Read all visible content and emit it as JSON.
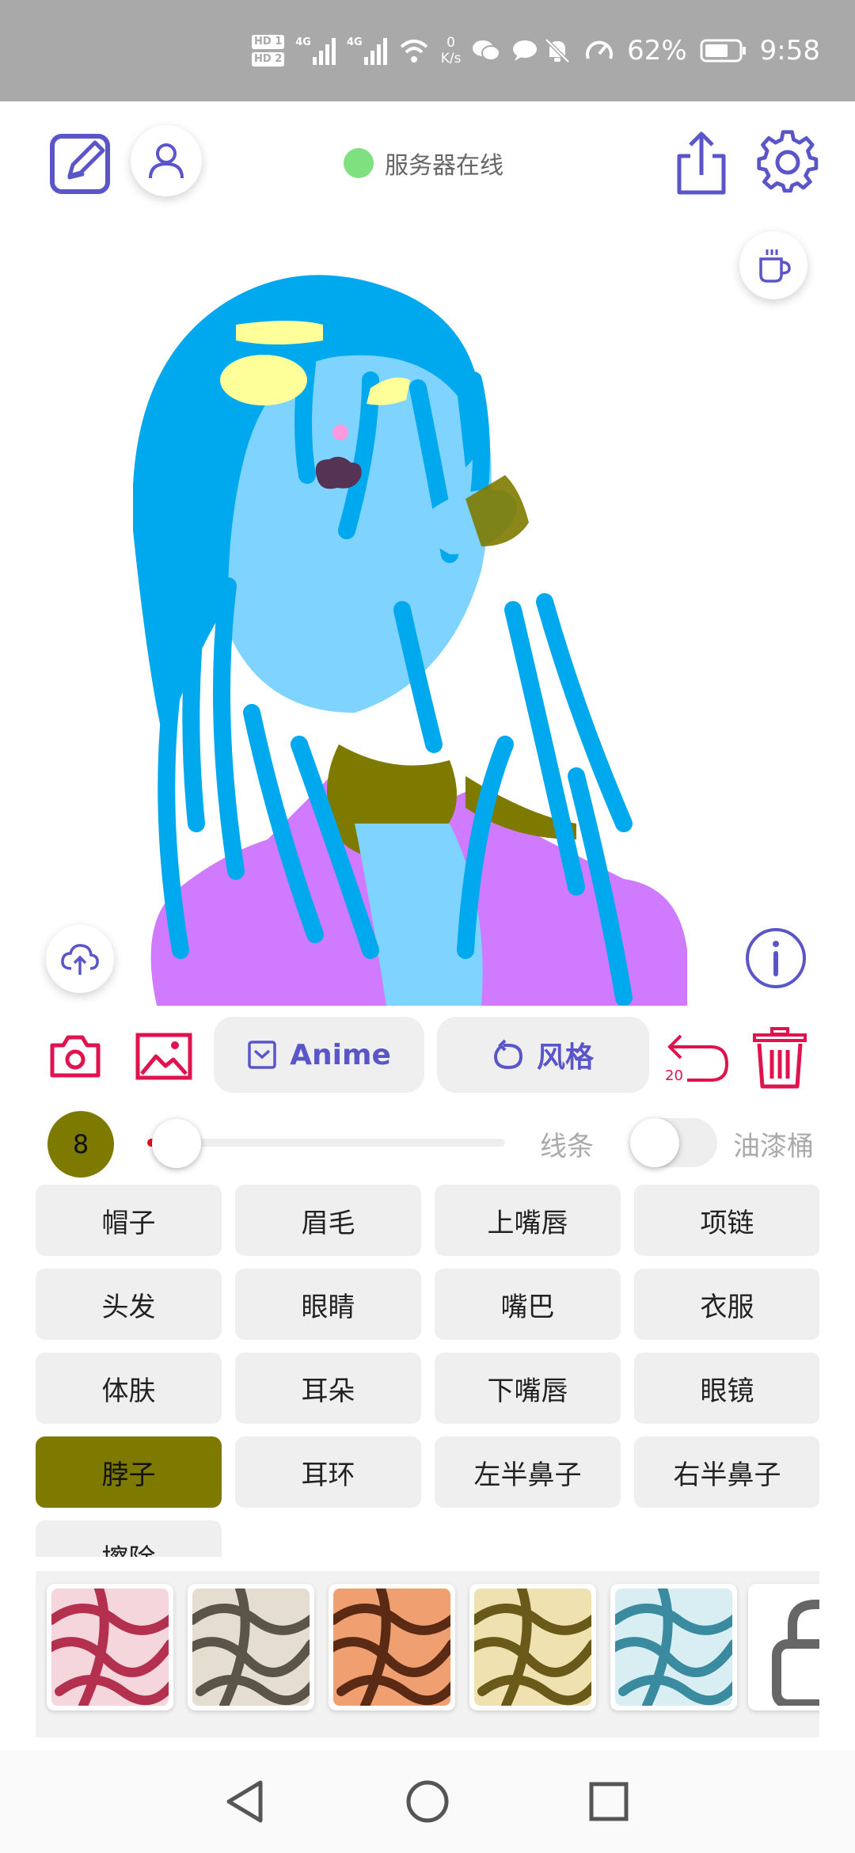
{
  "status_bar": {
    "sim1": "HD 1",
    "sim2": "HD 2",
    "net1": "4G",
    "net2": "4G",
    "speed_value": "0",
    "speed_unit": "K/s",
    "battery": "62%",
    "time": "9:58"
  },
  "header": {
    "server_status": "服务器在线",
    "server_status_color": "#7ee07e"
  },
  "tools": {
    "anime_label": "Anime",
    "style_label": "风格",
    "undo_count": "20",
    "accent_color": "#e0134f",
    "primary_color": "#5a55c8"
  },
  "brush": {
    "size": "8",
    "slider_level": 0.06,
    "mode_line": "线条",
    "mode_fill": "油漆桶",
    "fill_enabled": false
  },
  "parts": [
    {
      "label": "帽子",
      "active": false
    },
    {
      "label": "眉毛",
      "active": false
    },
    {
      "label": "上嘴唇",
      "active": false
    },
    {
      "label": "项链",
      "active": false
    },
    {
      "label": "头发",
      "active": false
    },
    {
      "label": "眼睛",
      "active": false
    },
    {
      "label": "嘴巴",
      "active": false
    },
    {
      "label": "衣服",
      "active": false
    },
    {
      "label": "体肤",
      "active": false
    },
    {
      "label": "耳朵",
      "active": false
    },
    {
      "label": "下嘴唇",
      "active": false
    },
    {
      "label": "眼镜",
      "active": false
    },
    {
      "label": "脖子",
      "active": true
    },
    {
      "label": "耳环",
      "active": false
    },
    {
      "label": "左半鼻子",
      "active": false
    },
    {
      "label": "右半鼻子",
      "active": false
    },
    {
      "label": "擦除",
      "active": false
    }
  ],
  "textures": [
    {
      "base": "#f4d6dc",
      "stroke": "#b3314f"
    },
    {
      "base": "#e4ddd0",
      "stroke": "#5a5548"
    },
    {
      "base": "#f0a070",
      "stroke": "#5a2a14"
    },
    {
      "base": "#efe2b0",
      "stroke": "#6a5a1a"
    },
    {
      "base": "#d8eef2",
      "stroke": "#3a8aa0"
    }
  ],
  "icons": {
    "edit": "edit-square-icon",
    "profile": "person-icon",
    "share": "share-upload-icon",
    "settings": "gear-icon",
    "coffee": "coffee-cup-icon",
    "cloud": "cloud-upload-icon",
    "info": "info-icon",
    "camera": "camera-icon",
    "gallery": "image-icon",
    "undo": "undo-icon",
    "delete": "trash-icon"
  }
}
